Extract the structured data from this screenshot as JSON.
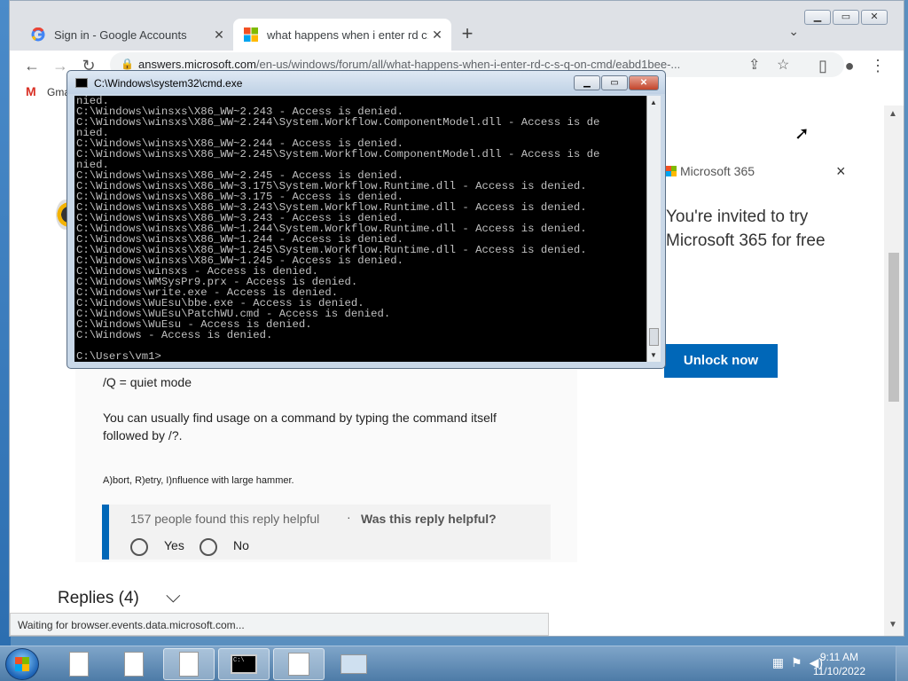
{
  "browser": {
    "tabs": [
      {
        "title": "Sign in - Google Accounts",
        "favicon": "google-icon",
        "active": false
      },
      {
        "title": "what happens when i enter rd c:\\",
        "favicon": "microsoft-icon",
        "active": true
      }
    ],
    "url_host": "answers.microsoft.com",
    "url_rest": "/en-us/windows/forum/all/what-happens-when-i-enter-rd-c-s-q-on-cmd/eabd1bee-...",
    "bookmark_gmail": "Gma",
    "status_text": "Waiting for browser.events.data.microsoft.com..."
  },
  "page": {
    "quiet_mode": "/Q = quiet mode",
    "usage_line1": "You can usually find usage on a command by typing the command itself",
    "usage_line2": "followed by /?.",
    "signature": "A)bort, R)etry, I)nfluence with large hammer.",
    "helpful_count": "157 people found this reply helpful",
    "helpful_sep": "·",
    "helpful_question": "Was this reply helpful?",
    "yes_label": "Yes",
    "no_label": "No",
    "replies_label": "Replies (4)"
  },
  "ad": {
    "brand": "Microsoft 365",
    "headline": "You're invited to try Microsoft 365 for free",
    "button": "Unlock now",
    "close": "×"
  },
  "cmd": {
    "title": "C:\\Windows\\system32\\cmd.exe",
    "output": "nied.\nC:\\Windows\\winsxs\\X86_WW~2.243 - Access is denied.\nC:\\Windows\\winsxs\\X86_WW~2.244\\System.Workflow.ComponentModel.dll - Access is de\nnied.\nC:\\Windows\\winsxs\\X86_WW~2.244 - Access is denied.\nC:\\Windows\\winsxs\\X86_WW~2.245\\System.Workflow.ComponentModel.dll - Access is de\nnied.\nC:\\Windows\\winsxs\\X86_WW~2.245 - Access is denied.\nC:\\Windows\\winsxs\\X86_WW~3.175\\System.Workflow.Runtime.dll - Access is denied.\nC:\\Windows\\winsxs\\X86_WW~3.175 - Access is denied.\nC:\\Windows\\winsxs\\X86_WW~3.243\\System.Workflow.Runtime.dll - Access is denied.\nC:\\Windows\\winsxs\\X86_WW~3.243 - Access is denied.\nC:\\Windows\\winsxs\\X86_WW~1.244\\System.Workflow.Runtime.dll - Access is denied.\nC:\\Windows\\winsxs\\X86_WW~1.244 - Access is denied.\nC:\\Windows\\winsxs\\X86_WW~1.245\\System.Workflow.Runtime.dll - Access is denied.\nC:\\Windows\\winsxs\\X86_WW~1.245 - Access is denied.\nC:\\Windows\\winsxs - Access is denied.\nC:\\Windows\\WMSysPr9.prx - Access is denied.\nC:\\Windows\\write.exe - Access is denied.\nC:\\Windows\\WuEsu\\bbe.exe - Access is denied.\nC:\\Windows\\WuEsu\\PatchWU.cmd - Access is denied.\nC:\\Windows\\WuEsu - Access is denied.\nC:\\Windows - Access is denied.\n\nC:\\Users\\vm1>"
  },
  "taskbar": {
    "time": "9:11 AM",
    "date": "11/10/2022"
  },
  "colors": {
    "accent": "#0067b8",
    "console_bg": "#000000",
    "console_text": "#c0c0c0"
  }
}
